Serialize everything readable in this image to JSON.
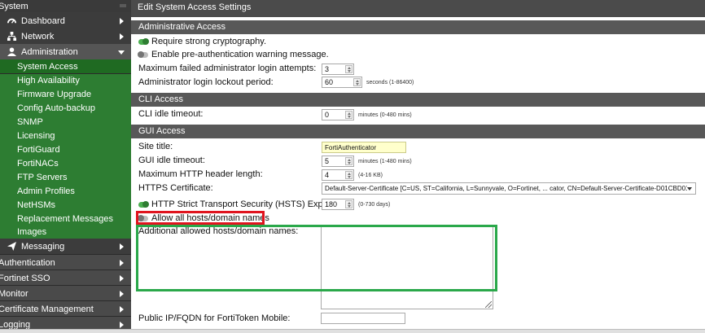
{
  "sidebar": {
    "header": "System",
    "items": [
      {
        "label": "Dashboard",
        "icon": "dashboard-icon"
      },
      {
        "label": "Network",
        "icon": "network-icon"
      },
      {
        "label": "Administration",
        "icon": "user-icon"
      },
      {
        "label": "System Access"
      },
      {
        "label": "High Availability"
      },
      {
        "label": "Firmware Upgrade"
      },
      {
        "label": "Config Auto-backup"
      },
      {
        "label": "SNMP"
      },
      {
        "label": "Licensing"
      },
      {
        "label": "FortiGuard"
      },
      {
        "label": "FortiNACs"
      },
      {
        "label": "FTP Servers"
      },
      {
        "label": "Admin Profiles"
      },
      {
        "label": "NetHSMs"
      },
      {
        "label": "Replacement Messages"
      },
      {
        "label": "Images"
      },
      {
        "label": "Messaging",
        "icon": "send-icon"
      },
      {
        "label": "Authentication"
      },
      {
        "label": "Fortinet SSO"
      },
      {
        "label": "Monitor"
      },
      {
        "label": "Certificate Management"
      },
      {
        "label": "Logging"
      }
    ]
  },
  "page": {
    "title": "Edit System Access Settings"
  },
  "admin_access": {
    "section": "Administrative Access",
    "strong_crypto": "Require strong cryptography.",
    "preauth_warning": "Enable pre-authentication warning message.",
    "max_failed_label": "Maximum failed administrator login attempts:",
    "max_failed_value": "3",
    "lockout_label": "Administrator login lockout period:",
    "lockout_value": "60",
    "lockout_hint": "seconds (1-86400)"
  },
  "cli_access": {
    "section": "CLI Access",
    "idle_label": "CLI idle timeout:",
    "idle_value": "0",
    "idle_hint": "minutes (0-480 mins)"
  },
  "gui_access": {
    "section": "GUI Access",
    "site_title_label": "Site title:",
    "site_title_value": "FortiAuthenticator",
    "gui_idle_label": "GUI idle timeout:",
    "gui_idle_value": "5",
    "gui_idle_hint": "minutes (1-480 mins)",
    "max_header_label": "Maximum HTTP header length:",
    "max_header_value": "4",
    "max_header_hint": "(4-16 KB)",
    "https_cert_label": "HTTPS Certificate:",
    "https_cert_value": "Default-Server-Certificate [C=US, ST=California, L=Sunnyvale, O=Fortinet, ... cator, CN=Default-Server-Certificate-D01CBD01]",
    "hsts_label": "HTTP Strict Transport Security (HSTS) Expiry",
    "hsts_value": "180",
    "hsts_hint": "(0-730 days)",
    "allow_all_label": "Allow all hosts/domain names",
    "additional_hosts_label": "Additional allowed hosts/domain names:",
    "public_ip_label": "Public IP/FQDN for FortiToken Mobile:"
  },
  "colors": {
    "sidebar_bg": "#3c3c3c",
    "sidebar_active": "#2d7d32",
    "section_bg": "#585858",
    "annotation_red": "#e0141e",
    "annotation_green": "#2aa84a"
  }
}
